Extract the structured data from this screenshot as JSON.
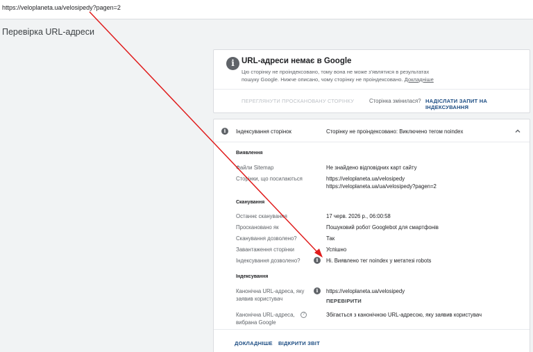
{
  "address_bar": {
    "url": "https://veloplaneta.ua/velosipedy?pagen=2"
  },
  "page": {
    "title": "Перевірка URL-адреси"
  },
  "status_card": {
    "title": "URL-адреси немає в Google",
    "description_line1": "Цю сторінку не проіндексовано, тому вона не може з'являтися в результатах",
    "description_line2": "пошуку Google. Нижче описано, чому сторінку не проіндексовано.",
    "more_link": "Докладніше",
    "view_crawled_button": "ПЕРЕГЛЯНУТИ ПРОСКАНОВАНУ СТОРІНКУ",
    "page_changed_text": "Сторінка змінилася?",
    "request_indexing_button": "НАДІСЛАТИ ЗАПИТ НА ІНДЕКСУВАННЯ"
  },
  "coverage": {
    "title": "Індексування сторінок",
    "status": "Сторінку не проіндексовано: Виключено тегом noindex",
    "discovery": {
      "heading": "Виявлення",
      "sitemaps_label": "Файли Sitemap",
      "sitemaps_value": "Не знайдено відповідних карт сайту",
      "referring_label": "Сторінки, що посилаються",
      "referring_values": [
        "https://veloplaneta.ua/velosipedy",
        "https://veloplaneta.ua/ua/velosipedy?pagen=2"
      ]
    },
    "crawl": {
      "heading": "Сканування",
      "last_crawl_label": "Останнє сканування",
      "last_crawl_value": "17 черв. 2026 р., 06:00:58",
      "crawled_as_label": "Проскановано як",
      "crawled_as_value": "Пошуковий робот Googlebot для смартфонів",
      "crawl_allowed_label": "Сканування дозволено?",
      "crawl_allowed_value": "Так",
      "page_fetch_label": "Завантаження сторінки",
      "page_fetch_value": "Успішно",
      "indexing_allowed_label": "Індексування дозволено?",
      "indexing_allowed_value": "Ні. Виявлено тег noindex у метатезі robots"
    },
    "indexing": {
      "heading": "Індексування",
      "user_canonical_label_1": "Канонічна URL-адреса, яку",
      "user_canonical_label_2": "заявив користувач",
      "user_canonical_value": "https://veloplaneta.ua/velosipedy",
      "inspect_button": "ПЕРЕВІРИТИ",
      "google_canonical_label_1": "Канонічна URL-адреса,",
      "google_canonical_label_2": "вибрана Google",
      "google_canonical_value": "Збігається з канонічною URL-адресою, яку заявив користувач"
    },
    "learn_more_button": "ДОКЛАДНІШЕ",
    "open_report_button": "ВІДКРИТИ ЗВІТ"
  },
  "colors": {
    "accent": "#1a4b82",
    "annotation_arrow": "#e01b1b"
  }
}
